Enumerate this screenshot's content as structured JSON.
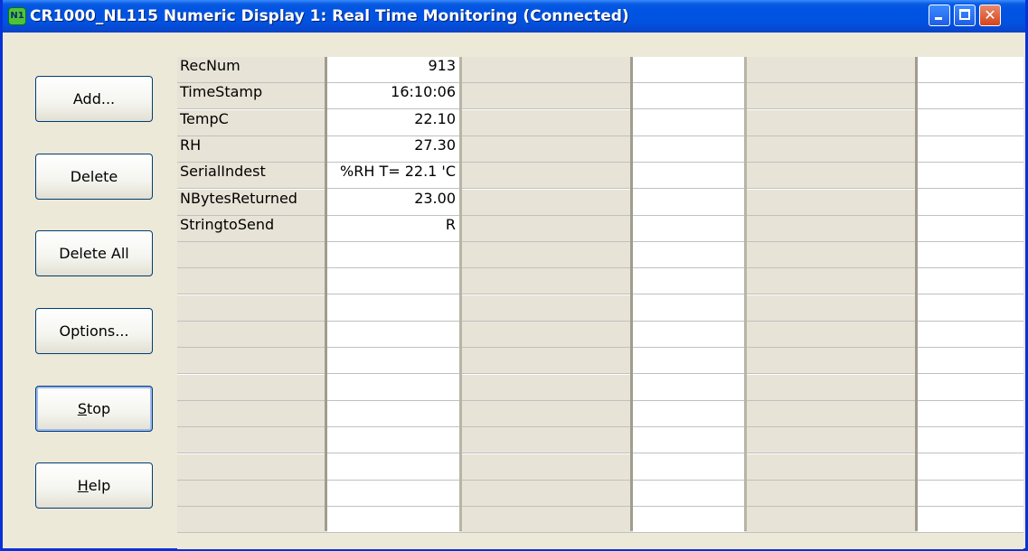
{
  "window": {
    "title": "CR1000_NL115 Numeric Display 1: Real Time Monitoring (Connected)",
    "icon_label": "N1"
  },
  "buttons": [
    {
      "label": "Add...",
      "mnemonic": ""
    },
    {
      "label": "Delete",
      "mnemonic": ""
    },
    {
      "label": "Delete All",
      "mnemonic": ""
    },
    {
      "label": "Options...",
      "mnemonic": ""
    },
    {
      "label": "Stop",
      "mnemonic": "S"
    },
    {
      "label": "Help",
      "mnemonic": "H"
    }
  ],
  "rows": [
    {
      "name": "RecNum",
      "value": "913"
    },
    {
      "name": "TimeStamp",
      "value": "16:10:06"
    },
    {
      "name": "TempC",
      "value": "22.10"
    },
    {
      "name": "RH",
      "value": "27.30"
    },
    {
      "name": "SerialIndest",
      "value": "%RH T= 22.1 'C"
    },
    {
      "name": "NBytesReturned",
      "value": "23.00"
    },
    {
      "name": "StringtoSend",
      "value": "R"
    }
  ],
  "total_rows": 18,
  "colors": {
    "titlebar": "#0054e3",
    "frame": "#0831d9",
    "name_cell": "#e7e3d6",
    "value_cell": "#ffffff"
  }
}
